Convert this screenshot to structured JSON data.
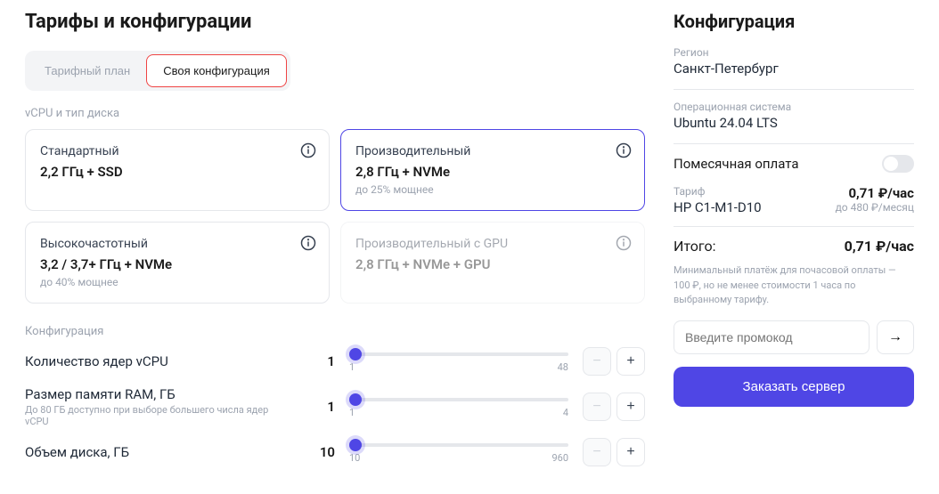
{
  "header": {
    "title": "Тарифы и конфигурации"
  },
  "tabs": {
    "plan": "Тарифный план",
    "custom": "Своя конфигурация"
  },
  "cpu_section_label": "vCPU и тип диска",
  "cpu_cards": [
    {
      "title": "Стандартный",
      "spec": "2,2 ГГц + SSD",
      "desc": ""
    },
    {
      "title": "Производительный",
      "spec": "2,8 ГГц + NVMe",
      "desc": "до 25% мощнее"
    },
    {
      "title": "Высокочастотный",
      "spec": "3,2 / 3,7+ ГГц + NVMe",
      "desc": "до 40% мощнее"
    },
    {
      "title": "Производительный с GPU",
      "spec": "2,8 ГГц + NVMe + GPU",
      "desc": ""
    }
  ],
  "config_label": "Конфигурация",
  "sliders": {
    "cpu": {
      "label": "Количество ядер vCPU",
      "value": "1",
      "min": "1",
      "max": "48",
      "hint": ""
    },
    "ram": {
      "label": "Размер памяти RAM, ГБ",
      "value": "1",
      "min": "1",
      "max": "4",
      "hint": "До 80 ГБ доступно при выборе большего числа ядер vCPU"
    },
    "disk": {
      "label": "Объем диска, ГБ",
      "value": "10",
      "min": "10",
      "max": "960",
      "hint": ""
    }
  },
  "summary": {
    "title": "Конфигурация",
    "region": {
      "label": "Регион",
      "value": "Санкт-Петербург"
    },
    "os": {
      "label": "Операционная система",
      "value": "Ubuntu 24.04 LTS"
    },
    "monthly_label": "Помесячная оплата",
    "tariff": {
      "label": "Тариф",
      "name": "HP C1-M1-D10",
      "price": "0,71 ₽/час",
      "monthly": "до 480 ₽/месяц"
    },
    "total": {
      "label": "Итого:",
      "price": "0,71 ₽/час"
    },
    "min_payment": "Минимальный платёж для почасовой оплаты — 100 ₽, но не менее стоимости 1 часа по выбранному тарифу.",
    "promo_placeholder": "Введите промокод",
    "order_label": "Заказать сервер"
  }
}
